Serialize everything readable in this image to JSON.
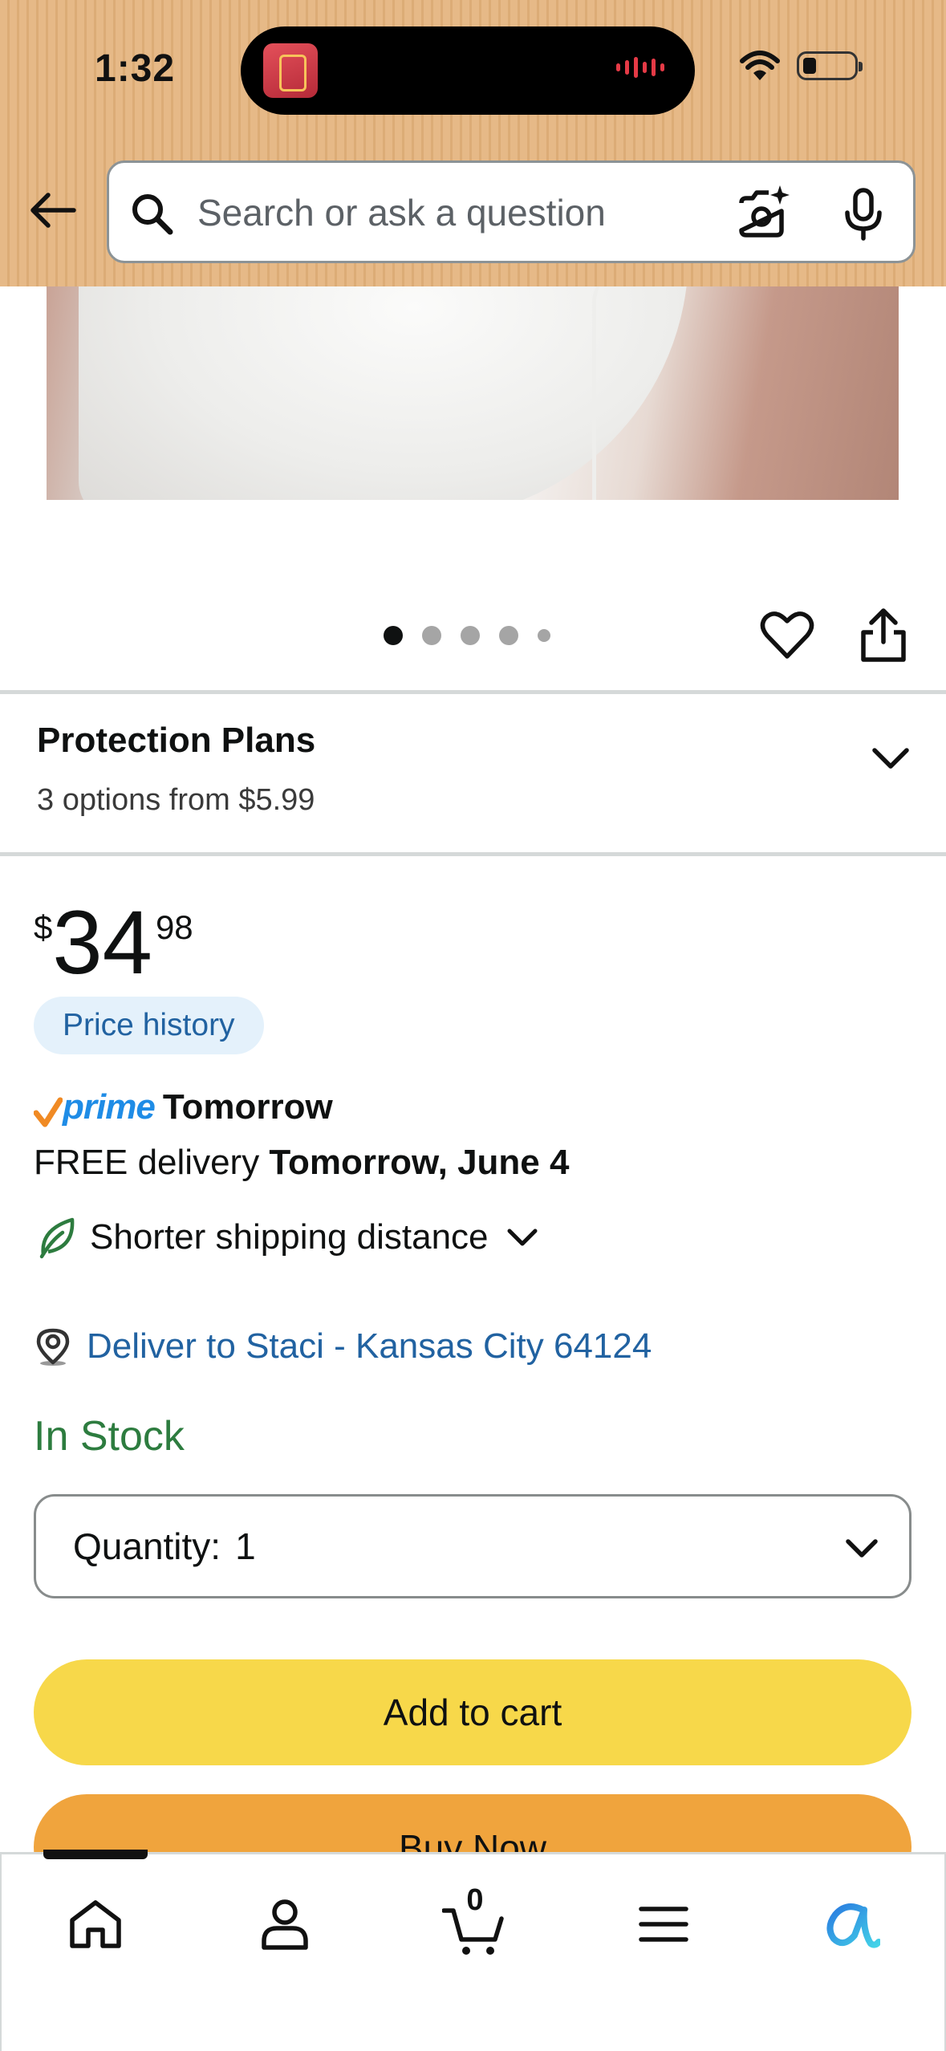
{
  "status_bar": {
    "time": "1:32"
  },
  "header": {
    "search_placeholder": "Search or ask a question"
  },
  "gallery": {
    "dot_count": 5,
    "active_index": 0
  },
  "protection_plans": {
    "title": "Protection Plans",
    "subtitle": "3 options from $5.99"
  },
  "price": {
    "symbol": "$",
    "whole": "34",
    "fraction": "98",
    "history_label": "Price history"
  },
  "delivery": {
    "prime_label": "prime",
    "prime_when": "Tomorrow",
    "free_prefix": "FREE delivery ",
    "free_date": "Tomorrow, June 4",
    "shipping_note": "Shorter shipping distance",
    "deliver_to": "Deliver to Staci - Kansas City 64124"
  },
  "stock": {
    "status": "In Stock"
  },
  "quantity": {
    "label": "Quantity:",
    "value": "1"
  },
  "actions": {
    "add_to_cart": "Add to cart",
    "buy_now": "Buy Now"
  },
  "bottom_nav": {
    "cart_count": "0",
    "items": [
      "home-icon",
      "account-icon",
      "cart-icon",
      "menu-icon",
      "rufus-icon"
    ]
  },
  "colors": {
    "header_bg": "#e6b987",
    "link_blue": "#2162a1",
    "stock_green": "#2d7c3f",
    "add_to_cart": "#f7d84a",
    "buy_now": "#f0a43d",
    "prime_blue": "#1f8ce6"
  }
}
